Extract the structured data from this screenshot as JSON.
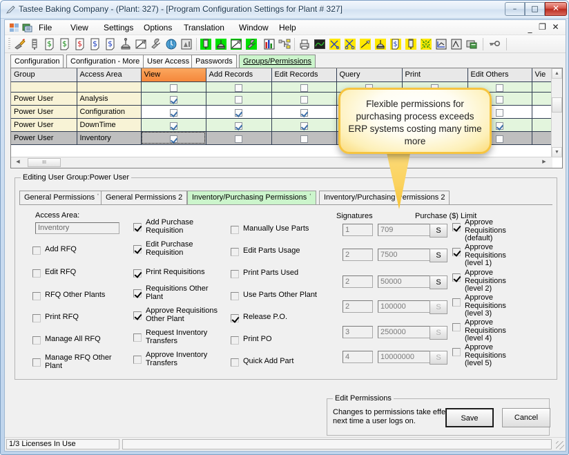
{
  "window": {
    "title": "Tastee Baking Company - (Plant: 327) - [Program Configuration Settings for  Plant #  327]",
    "icon": "pen-icon",
    "minimize": "–",
    "maximize": "□",
    "close": "✕"
  },
  "mdi": {
    "minimize": "_",
    "restore": "❐",
    "close": "✕"
  },
  "menu": {
    "items": [
      {
        "label": "File"
      },
      {
        "label": "View"
      },
      {
        "label": "Settings"
      },
      {
        "label": "Options"
      },
      {
        "label": "Translation"
      },
      {
        "label": "Window"
      },
      {
        "label": "Help"
      }
    ]
  },
  "toolbar": {
    "icons": [
      "torch-icon",
      "probe-icon",
      "dollar-doc-green-icon",
      "dollar-doc-green2-icon",
      "dollar-doc-red-icon",
      "dollar-doc-blue-icon",
      "dollar-doc-blue2-icon",
      "scale-icon",
      "chart-pencil-icon",
      "wrench-icon",
      "clock-globe-icon",
      "report-icon",
      "green-meter-icon",
      "green-scale-icon",
      "green-chart-icon",
      "green-wrench-icon",
      "bar-chart-icon",
      "network-icon",
      "printer-icon",
      "monitor-icon",
      "yellow-cut-icon",
      "yellow-scissors-icon",
      "yellow-chart-icon",
      "yellow-scale-icon",
      "yellow-dollar-doc-icon",
      "yellow-probe-icon",
      "yellow-gears-icon",
      "graph-u-icon",
      "graph-a-icon",
      "server-icon",
      "key-icon"
    ]
  },
  "outer_tabs": [
    {
      "label": "Configuration",
      "active": false
    },
    {
      "label": "Configuration - More",
      "active": false
    },
    {
      "label": "User Access",
      "active": false
    },
    {
      "label": "Passwords",
      "active": false
    },
    {
      "label": "Groups/Permissions",
      "active": true
    }
  ],
  "grid": {
    "columns": [
      {
        "label": "Group",
        "highlight": false
      },
      {
        "label": "Access Area",
        "highlight": false
      },
      {
        "label": "View",
        "highlight": true
      },
      {
        "label": "Add Records",
        "highlight": false
      },
      {
        "label": "Edit Records",
        "highlight": false
      },
      {
        "label": "Query",
        "highlight": false
      },
      {
        "label": "Print",
        "highlight": false
      },
      {
        "label": "Edit Others",
        "highlight": false
      },
      {
        "label": "Vie",
        "highlight": false
      }
    ],
    "rows": [
      {
        "group": "Power User",
        "area": "Analysis",
        "selected": false,
        "alt": true,
        "checks": [
          true,
          false,
          false,
          false,
          false,
          false,
          false
        ]
      },
      {
        "group": "Power User",
        "area": "Configuration",
        "selected": false,
        "alt": false,
        "checks": [
          true,
          true,
          true,
          false,
          false,
          false,
          false
        ]
      },
      {
        "group": "Power User",
        "area": "DownTime",
        "selected": false,
        "alt": true,
        "checks": [
          true,
          true,
          true,
          false,
          false,
          true,
          false
        ]
      },
      {
        "group": "Power User",
        "area": "Inventory",
        "selected": true,
        "alt": false,
        "checks": [
          true,
          false,
          false,
          false,
          false,
          false,
          false
        ]
      }
    ],
    "hscroll_thumb": "III"
  },
  "edit_group": {
    "legend": "Editing User Group:Power User",
    "inner_tabs": [
      {
        "label": "General Permissions ˈ",
        "active": false
      },
      {
        "label": "General Permissions 2",
        "active": false
      },
      {
        "label": "Inventory/Purchasing Permissions ˈ",
        "active": true
      },
      {
        "label": "Inventory/Purchasing Permissions 2",
        "active": false
      }
    ],
    "access_area_label": "Access Area:",
    "access_area_value": "Inventory",
    "column1": [
      {
        "label": "Add RFQ",
        "checked": false
      },
      {
        "label": "Edit RFQ",
        "checked": false
      },
      {
        "label": "RFQ Other Plants",
        "checked": false
      },
      {
        "label": "Print RFQ",
        "checked": false
      },
      {
        "label": "Manage All RFQ",
        "checked": false
      },
      {
        "label": "Manage RFQ Other Plant",
        "checked": false
      }
    ],
    "column2": [
      {
        "label": "Add Purchase Requisition",
        "checked": true
      },
      {
        "label": "Edit Purchase Requisition",
        "checked": true
      },
      {
        "label": "Print Requisitions",
        "checked": true
      },
      {
        "label": "Requisitions Other Plant",
        "checked": true
      },
      {
        "label": "Approve Requisitions Other Plant",
        "checked": true
      },
      {
        "label": "Request Inventory Transfers",
        "checked": false
      },
      {
        "label": "Approve Inventory Transfers",
        "checked": false
      }
    ],
    "column3": [
      {
        "label": "Manually Use Parts",
        "checked": false
      },
      {
        "label": "Edit Parts Usage",
        "checked": false
      },
      {
        "label": "Print Parts Used",
        "checked": false
      },
      {
        "label": "Use Parts Other Plant",
        "checked": false
      },
      {
        "label": "Release P.O.",
        "checked": true
      },
      {
        "label": "Print PO",
        "checked": false
      },
      {
        "label": "Quick Add Part",
        "checked": false
      }
    ],
    "signatures_header": "Signatures",
    "limit_header": "Purchase ($) Limit",
    "approval_rows": [
      {
        "signatures": "1",
        "limit": "709",
        "s_button": "S",
        "s_enabled": true,
        "label": "Approve Requisitions (default)",
        "checked": true
      },
      {
        "signatures": "2",
        "limit": "7500",
        "s_button": "S",
        "s_enabled": true,
        "label": "Approve Requisitions (level 1)",
        "checked": true
      },
      {
        "signatures": "2",
        "limit": "50000",
        "s_button": "S",
        "s_enabled": true,
        "label": "Approve Requisitions (level 2)",
        "checked": true
      },
      {
        "signatures": "2",
        "limit": "100000",
        "s_button": "S",
        "s_enabled": false,
        "label": "Approve Requisitions (level 3)",
        "checked": false
      },
      {
        "signatures": "3",
        "limit": "250000",
        "s_button": "S",
        "s_enabled": false,
        "label": "Approve Requisitions (level 4)",
        "checked": false
      },
      {
        "signatures": "4",
        "limit": "10000000",
        "s_button": "S",
        "s_enabled": false,
        "label": "Approve Requisitions (level 5)",
        "checked": false
      }
    ]
  },
  "edit_permissions": {
    "legend": "Edit Permissions",
    "note": "Changes to permissions take effect next time a user logs on.",
    "save_label": "Save",
    "cancel_label": "Cancel"
  },
  "status_bar": {
    "licenses": "1/3 Licenses In Use"
  },
  "callout": {
    "text": "Flexible permissions for purchasing process exceeds ERP systems costing many time more",
    "border_color": "#f6c440",
    "fill_color": "#fffdf2"
  }
}
